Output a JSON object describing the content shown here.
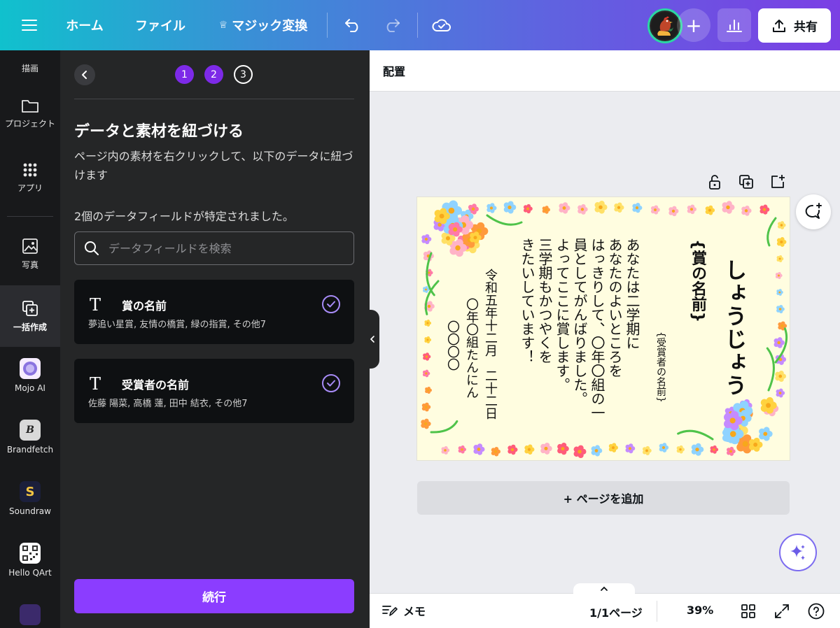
{
  "topbar": {
    "home": "ホーム",
    "file": "ファイル",
    "magic": "マジック変換",
    "share": "共有",
    "add": "+"
  },
  "rail": {
    "items": [
      {
        "label": "描画",
        "icon": "draw-icon"
      },
      {
        "label": "プロジェクト",
        "icon": "folder-icon"
      },
      {
        "label": "アプリ",
        "icon": "apps-grid-icon"
      },
      {
        "label": "写真",
        "icon": "photo-icon"
      },
      {
        "label": "一括作成",
        "icon": "bulk-create-icon"
      },
      {
        "label": "Mojo AI",
        "icon": "mojo-ai-icon"
      },
      {
        "label": "Brandfetch",
        "icon": "brandfetch-icon"
      },
      {
        "label": "Soundraw",
        "icon": "soundraw-icon"
      },
      {
        "label": "Hello QArt",
        "icon": "hello-qart-icon"
      }
    ]
  },
  "panel": {
    "steps": [
      "1",
      "2",
      "3"
    ],
    "title": "データと素材を紐づける",
    "description": "ページ内の素材を右クリックして、以下のデータに紐づけます",
    "fields_found": "2個のデータフィールドが特定されました。",
    "search_placeholder": "データフィールドを検索",
    "fields": [
      {
        "name": "賞の名前",
        "values": "夢追い星賞, 友情の橋賞, 緑の指賞, その他7"
      },
      {
        "name": "受賞者の名前",
        "values": "佐藤 陽菜, 高橋 蓮, 田中 結衣, その他7"
      }
    ],
    "continue": "続行"
  },
  "canvas": {
    "position_label": "配置",
    "add_page": "+ ページを追加",
    "certificate": {
      "title": "しょうじょう",
      "award_placeholder": "{賞の名前}",
      "recipient_placeholder": "{受賞者の名前}",
      "body_lines": [
        "あなたは二学期に",
        "あなたのよいところを",
        "はっきりして、〇年〇組の一",
        "員としてがんばりました。",
        "よってここに賞します。",
        "三学期もかつやくを",
        "きたいしています！"
      ],
      "date": "令和五年十二月　二十二日",
      "issuer": "〇年〇組たんにん",
      "signature": "〇〇〇〇"
    }
  },
  "bottombar": {
    "notes": "メモ",
    "page_count": "1/1ページ",
    "zoom": "39%"
  },
  "colors": {
    "accent": "#8b3dff",
    "step_done": "#7d2ae8",
    "check": "#a88cf8",
    "panel_bg": "#252627",
    "rail_bg": "#18191b"
  }
}
